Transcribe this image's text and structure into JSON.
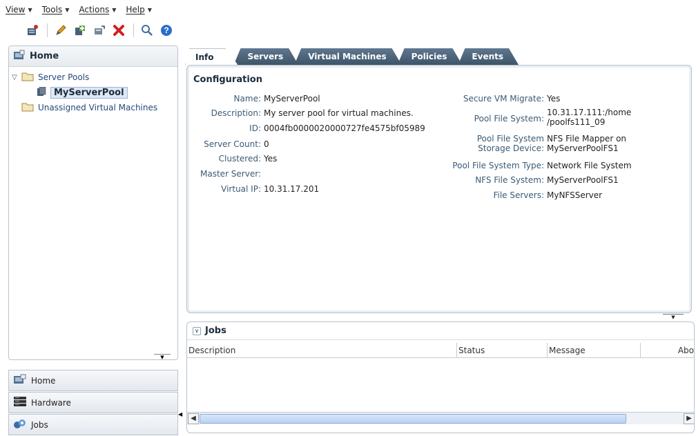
{
  "menubar": {
    "items": [
      {
        "label": "View"
      },
      {
        "label": "Tools"
      },
      {
        "label": "Actions"
      },
      {
        "label": "Help"
      }
    ]
  },
  "toolbar": {
    "icons": [
      "create-server-pool-icon",
      "edit-icon",
      "add-remove-icon",
      "discover-icon",
      "delete-icon",
      "search-icon",
      "help-icon"
    ]
  },
  "navigator": {
    "title": "Home",
    "tree": [
      {
        "label": "Server Pools",
        "expanded": true
      },
      {
        "label": "MyServerPool",
        "selected": true
      },
      {
        "label": "Unassigned Virtual Machines"
      }
    ]
  },
  "accordion": [
    {
      "label": "Home",
      "icon": "home-icon"
    },
    {
      "label": "Hardware",
      "icon": "hardware-icon"
    },
    {
      "label": "Jobs",
      "icon": "jobs-icon"
    }
  ],
  "tabs": [
    {
      "label": "Info",
      "active": true
    },
    {
      "label": "Servers"
    },
    {
      "label": "Virtual Machines"
    },
    {
      "label": "Policies"
    },
    {
      "label": "Events"
    }
  ],
  "info": {
    "section_title": "Configuration",
    "left_fields": [
      {
        "label": "Name:",
        "value": "MyServerPool"
      },
      {
        "label": "Description:",
        "value": "My server pool for virtual machines."
      },
      {
        "label": "ID:",
        "value": "0004fb0000020000727fe4575bf05989"
      },
      {
        "label": "Server Count:",
        "value": "0"
      },
      {
        "label": "Clustered:",
        "value": "Yes"
      },
      {
        "label": "Master Server:",
        "value": ""
      },
      {
        "label": "Virtual IP:",
        "value": "10.31.17.201"
      }
    ],
    "right_fields": [
      {
        "label": "Secure VM Migrate:",
        "value": "Yes"
      },
      {
        "label": "Pool File System:",
        "value": "10.31.17.111:/home",
        "value2": "/poolfs111_09"
      },
      {
        "label": "Pool File System",
        "label2": "Storage Device:",
        "value": "NFS File Mapper on",
        "value2": "MyServerPoolFS1"
      },
      {
        "label": "Pool File System Type:",
        "value": "Network File System"
      },
      {
        "label": "NFS File System:",
        "value": "MyServerPoolFS1"
      },
      {
        "label": "File Servers:",
        "value": "MyNFSServer"
      }
    ]
  },
  "jobs": {
    "title": "Jobs",
    "columns": [
      "Description",
      "Status",
      "Message",
      "Abo"
    ]
  },
  "colors": {
    "accent": "#3d5468",
    "link": "#27477a",
    "label": "#3a5a75"
  }
}
